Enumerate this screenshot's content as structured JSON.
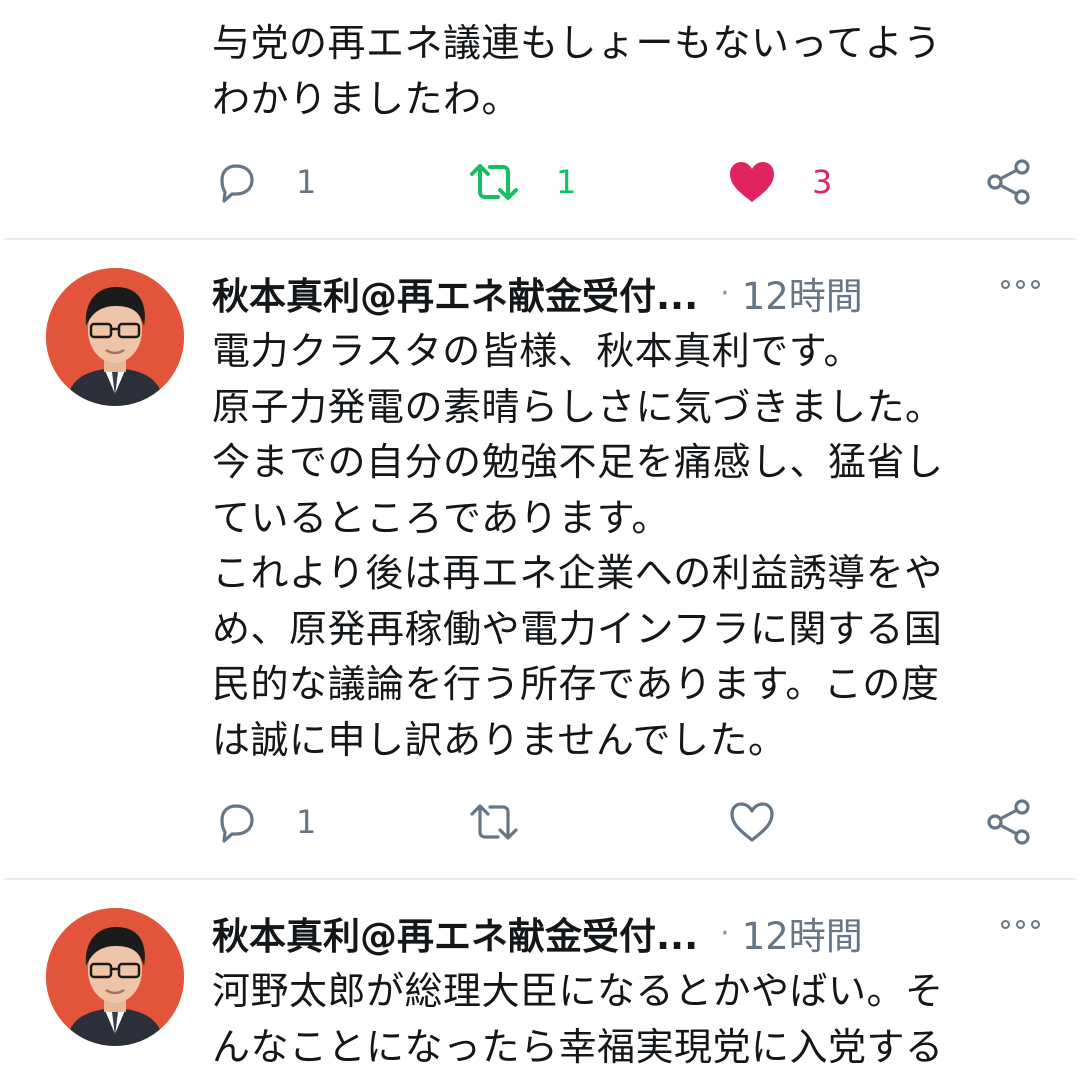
{
  "tweets": [
    {
      "body_lines": [
        "与党の再エネ議連もしょーもないってよう",
        "わかりましたわ。"
      ],
      "actions": {
        "reply_count": "1",
        "retweet_count": "1",
        "like_count": "3",
        "liked": true,
        "retweeted": true
      }
    },
    {
      "author": "秋本真利@再エネ献金受付...",
      "separator": "·",
      "time": "12時間",
      "body_lines": [
        "電力クラスタの皆様、秋本真利です。",
        "原子力発電の素晴らしさに気づきました。",
        "今までの自分の勉強不足を痛感し、猛省し",
        "ているところであります。",
        "これより後は再エネ企業への利益誘導をや",
        "め、原発再稼働や電力インフラに関する国",
        "民的な議論を行う所存であります。この度",
        "は誠に申し訳ありませんでした。"
      ],
      "actions": {
        "reply_count": "1",
        "retweet_count": "",
        "like_count": "",
        "liked": false,
        "retweeted": false
      }
    },
    {
      "author": "秋本真利@再エネ献金受付...",
      "separator": "·",
      "time": "12時間",
      "body_lines": [
        "河野太郎が総理大臣になるとかやばい。そ",
        "んなことになったら幸福実現党に入党する"
      ]
    }
  ],
  "colors": {
    "reply": "#657786",
    "retweet_active": "#17bf63",
    "like_active": "#e0245e",
    "avatar_bg": "#e2553a"
  },
  "icons": [
    "reply-icon",
    "retweet-icon",
    "like-icon",
    "share-icon",
    "more-icon"
  ]
}
